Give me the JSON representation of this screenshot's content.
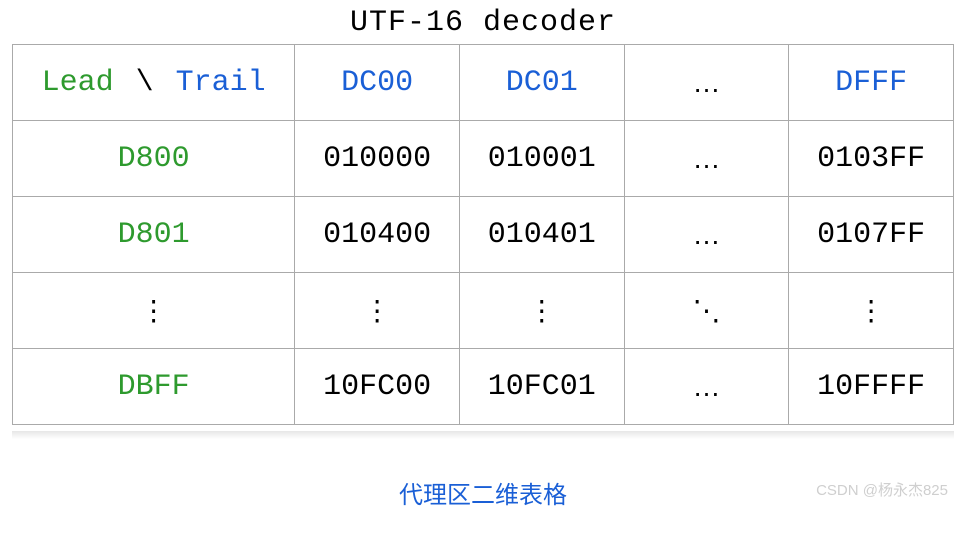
{
  "title": "UTF-16 decoder",
  "header": {
    "lead_label": "Lead",
    "slash": "\\",
    "trail_label": "Trail",
    "cols": [
      "DC00",
      "DC01",
      "…",
      "DFFF"
    ]
  },
  "rows": [
    {
      "lead": "D800",
      "cells": [
        "010000",
        "010001",
        "…",
        "0103FF"
      ]
    },
    {
      "lead": "D801",
      "cells": [
        "010400",
        "010401",
        "…",
        "0107FF"
      ]
    },
    {
      "lead": "⋮",
      "cells": [
        "⋮",
        "⋮",
        "⋱",
        "⋮"
      ]
    },
    {
      "lead": "DBFF",
      "cells": [
        "10FC00",
        "10FC01",
        "…",
        "10FFFF"
      ]
    }
  ],
  "caption": "代理区二维表格",
  "watermark": "CSDN @杨永杰825"
}
